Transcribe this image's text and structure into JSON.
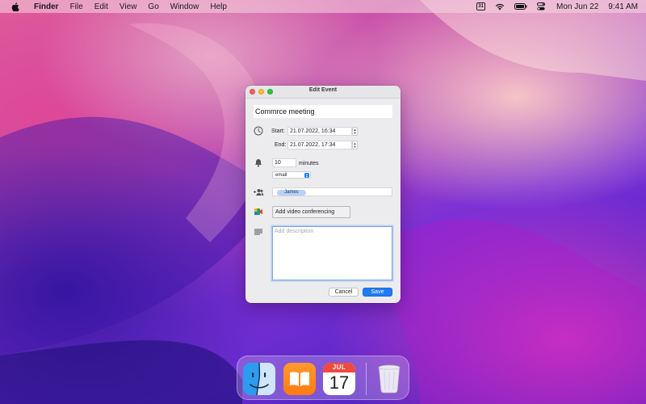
{
  "menubar": {
    "app_name": "Finder",
    "menus": [
      "File",
      "Edit",
      "View",
      "Go",
      "Window",
      "Help"
    ],
    "calendar_badge": "31",
    "date": "Mon Jun 22",
    "time": "9:41 AM"
  },
  "window": {
    "title": "Edit Event",
    "event_title": "Commrce meeting",
    "start_label": "Start:",
    "start_value": "21.07.2022, 16:34",
    "end_label": "End:",
    "end_value": "21.07.2022, 17:34",
    "alert_minutes": "10",
    "alert_unit": "minutes",
    "alert_type": "email",
    "guest": "James",
    "video_button": "Add video conferencing",
    "description_placeholder": "Add description",
    "cancel_label": "Cancel",
    "save_label": "Save"
  },
  "dock": {
    "items": [
      "finder",
      "books",
      "calendar",
      "trash"
    ],
    "calendar_month": "JUL",
    "calendar_day": "17"
  },
  "colors": {
    "accent": "#1f7bf6",
    "token_bg": "#b6d2f9",
    "close": "#ff5f57",
    "minimize": "#febc2e",
    "zoom": "#28c840"
  }
}
